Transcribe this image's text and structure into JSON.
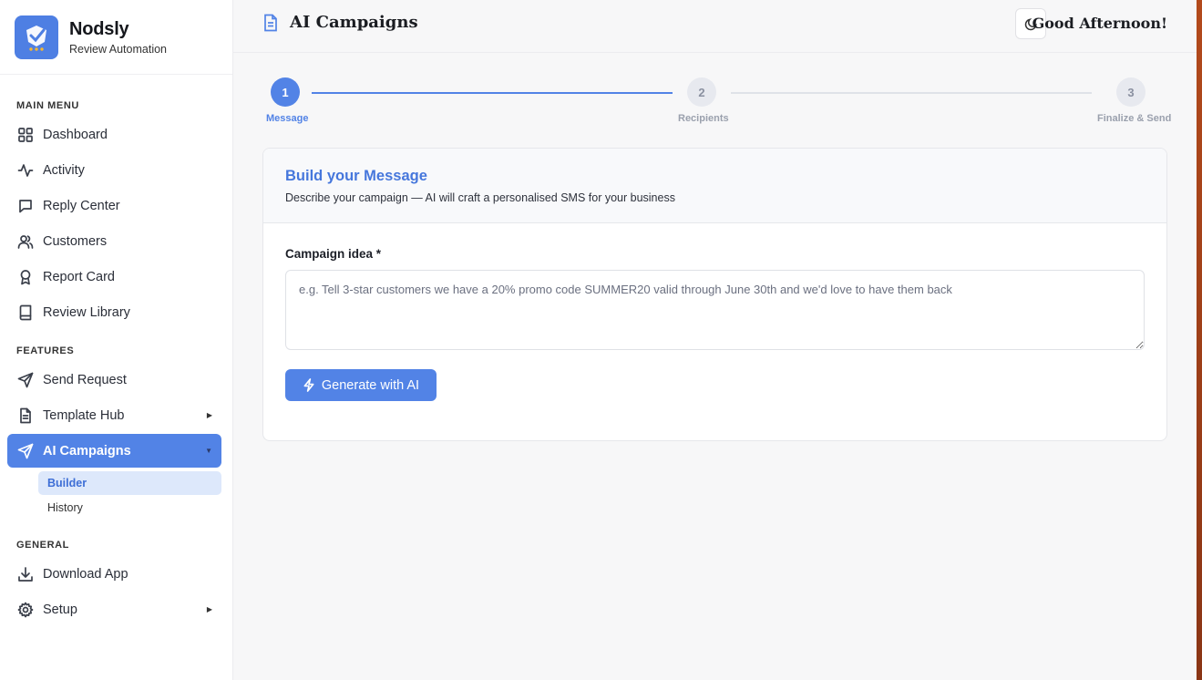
{
  "brand": {
    "name": "Nodsly",
    "subtitle": "Review Automation"
  },
  "sidebar": {
    "sections": {
      "main": "MAIN MENU",
      "features": "FEATURES",
      "general": "GENERAL"
    },
    "main_items": [
      {
        "label": "Dashboard",
        "icon": "grid-icon"
      },
      {
        "label": "Activity",
        "icon": "activity-icon"
      },
      {
        "label": "Reply Center",
        "icon": "chat-bubble-icon"
      },
      {
        "label": "Customers",
        "icon": "users-icon"
      },
      {
        "label": "Report Card",
        "icon": "award-icon"
      },
      {
        "label": "Review Library",
        "icon": "book-icon"
      }
    ],
    "feature_items": [
      {
        "label": "Send Request",
        "icon": "send-icon"
      },
      {
        "label": "Template Hub",
        "icon": "file-text-icon"
      },
      {
        "label": "AI Campaigns",
        "icon": "send-icon",
        "active": true
      }
    ],
    "ai_sub_items": [
      {
        "label": "Builder",
        "active": true
      },
      {
        "label": "History"
      }
    ],
    "general_items": [
      {
        "label": "Download App",
        "icon": "download-icon"
      },
      {
        "label": "Setup",
        "icon": "gear-icon"
      }
    ]
  },
  "header": {
    "title": "AI Campaigns",
    "greeting": "Good Afternoon!",
    "theme_toggle_icon": "moon-icon"
  },
  "stepper": {
    "steps": [
      {
        "number": "1",
        "label": "Message",
        "state": "current"
      },
      {
        "number": "2",
        "label": "Recipients",
        "state": "pending"
      },
      {
        "number": "3",
        "label": "Finalize & Send",
        "state": "pending"
      }
    ]
  },
  "card": {
    "title": "Build your Message",
    "description": "Describe your campaign — AI will craft a personalised SMS for your business",
    "field_label": "Campaign idea *",
    "placeholder": "e.g. Tell 3-star customers we have a 20% promo code SUMMER20 valid through June 30th and we'd love to have them back",
    "value": "",
    "button_label": "Generate with AI"
  },
  "colors": {
    "accent": "#5283e6",
    "accent_light": "#dde8fb",
    "edge_strip": "#b34a1c"
  }
}
